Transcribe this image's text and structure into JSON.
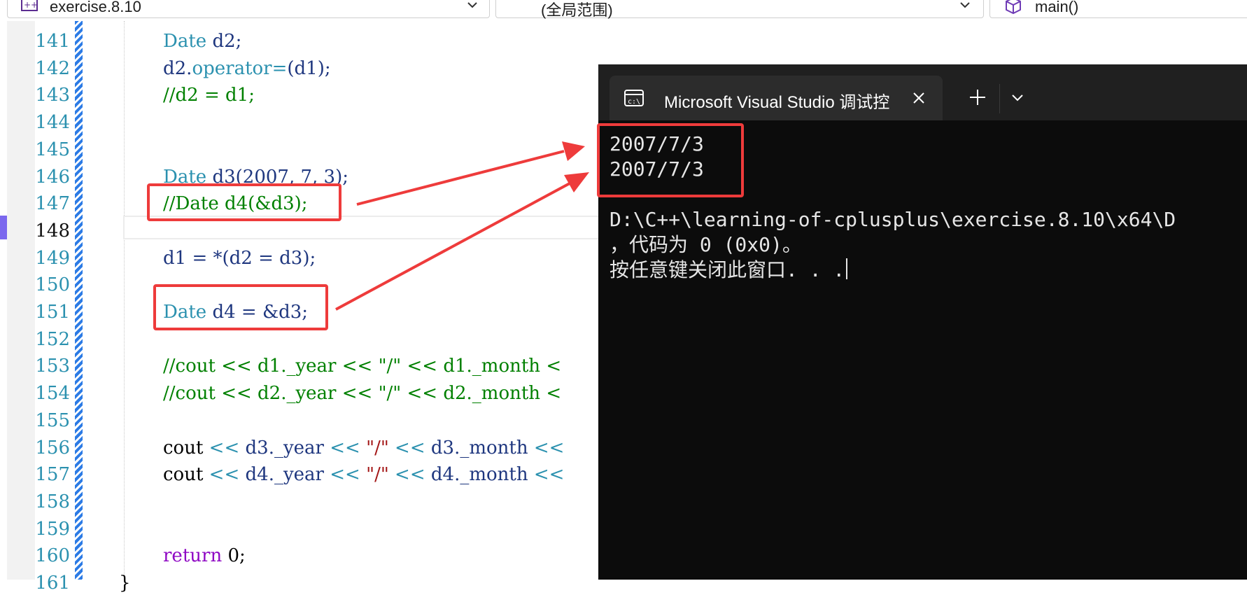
{
  "navbar": {
    "project": "exercise.8.10",
    "scope": "(全局范围)",
    "function": "main()"
  },
  "editor": {
    "lines": [
      {
        "num": "141",
        "code": [
          {
            "t": "Date",
            "c": "kw"
          },
          {
            "t": " d2;",
            "c": "id"
          }
        ]
      },
      {
        "num": "142",
        "code": [
          {
            "t": "d2.",
            "c": "id"
          },
          {
            "t": "operator=",
            "c": "fn"
          },
          {
            "t": "(d1);",
            "c": "id"
          }
        ]
      },
      {
        "num": "143",
        "code": [
          {
            "t": "//d2 = d1;",
            "c": "cm"
          }
        ]
      },
      {
        "num": "144",
        "code": []
      },
      {
        "num": "145",
        "code": []
      },
      {
        "num": "146",
        "code": [
          {
            "t": "Date",
            "c": "kw"
          },
          {
            "t": " d3(2007, 7, 3);",
            "c": "id"
          }
        ]
      },
      {
        "num": "147",
        "code": [
          {
            "t": "//Date d4(&d3);",
            "c": "cm"
          }
        ]
      },
      {
        "num": "148",
        "code": []
      },
      {
        "num": "149",
        "code": [
          {
            "t": "d1 = *(d2 = d3);",
            "c": "id"
          }
        ]
      },
      {
        "num": "150",
        "code": []
      },
      {
        "num": "151",
        "code": [
          {
            "t": "Date",
            "c": "kw"
          },
          {
            "t": " d4 = &d3;",
            "c": "id"
          }
        ]
      },
      {
        "num": "152",
        "code": []
      },
      {
        "num": "153",
        "code": [
          {
            "t": "//cout << d1._year << \"/\" << d1._month <",
            "c": "cm"
          }
        ]
      },
      {
        "num": "154",
        "code": [
          {
            "t": "//cout << d2._year << \"/\" << d2._month <",
            "c": "cm"
          }
        ]
      },
      {
        "num": "155",
        "code": []
      },
      {
        "num": "156",
        "code": [
          {
            "t": "cout",
            "c": "op"
          },
          {
            "t": " << ",
            "c": "kw"
          },
          {
            "t": "d3._year",
            "c": "id"
          },
          {
            "t": " << ",
            "c": "kw"
          },
          {
            "t": "\"/\"",
            "c": "str"
          },
          {
            "t": " << ",
            "c": "kw"
          },
          {
            "t": "d3._month",
            "c": "id"
          },
          {
            "t": " <<",
            "c": "kw"
          }
        ]
      },
      {
        "num": "157",
        "code": [
          {
            "t": "cout",
            "c": "op"
          },
          {
            "t": " << ",
            "c": "kw"
          },
          {
            "t": "d4._year",
            "c": "id"
          },
          {
            "t": " << ",
            "c": "kw"
          },
          {
            "t": "\"/\"",
            "c": "str"
          },
          {
            "t": " << ",
            "c": "kw"
          },
          {
            "t": "d4._month",
            "c": "id"
          },
          {
            "t": " <<",
            "c": "kw"
          }
        ]
      },
      {
        "num": "158",
        "code": []
      },
      {
        "num": "159",
        "code": []
      },
      {
        "num": "160",
        "code": [
          {
            "t": "return",
            "c": "ret"
          },
          {
            "t": " 0;",
            "c": "op"
          }
        ]
      },
      {
        "num": "161",
        "code": []
      }
    ],
    "current_line": "148",
    "closing_brace": "}"
  },
  "console": {
    "tab_title": "Microsoft Visual Studio 调试控",
    "output_line_1": "2007/7/3",
    "output_line_2": "2007/7/3",
    "exit_line_1": "D:\\C++\\learning-of-cplusplus\\exercise.8.10\\x64\\D",
    "exit_line_2": "，代码为 0 (0x0)。",
    "exit_line_3": "按任意键关闭此窗口. . ."
  },
  "colors": {
    "annotation": "#ee3b3b",
    "console_bg": "#0c0c0c",
    "keyword": "#2b91af",
    "comment": "#008000"
  }
}
